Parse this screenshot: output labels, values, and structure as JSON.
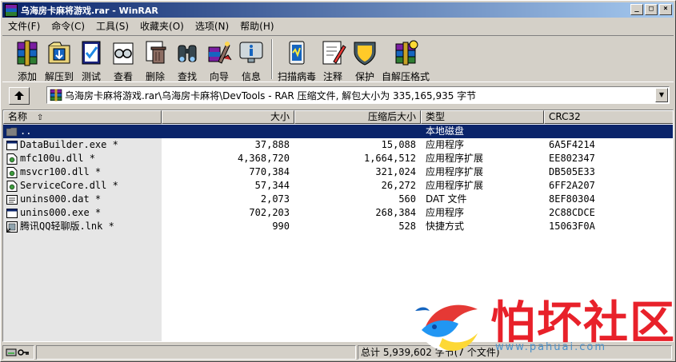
{
  "window": {
    "title": "乌海房卡麻将游戏.rar - WinRAR",
    "controls": {
      "minimize": "_",
      "maximize": "□",
      "close": "×"
    }
  },
  "menu": [
    "文件(F)",
    "命令(C)",
    "工具(S)",
    "收藏夹(O)",
    "选项(N)",
    "帮助(H)"
  ],
  "toolbar": [
    {
      "label": "添加",
      "icon": "add-archive-icon"
    },
    {
      "label": "解压到",
      "icon": "extract-to-icon"
    },
    {
      "label": "测试",
      "icon": "test-icon"
    },
    {
      "label": "查看",
      "icon": "view-icon"
    },
    {
      "label": "删除",
      "icon": "delete-icon"
    },
    {
      "label": "查找",
      "icon": "find-icon"
    },
    {
      "label": "向导",
      "icon": "wizard-icon"
    },
    {
      "label": "信息",
      "icon": "info-icon"
    },
    {
      "label": "扫描病毒",
      "icon": "virus-scan-icon"
    },
    {
      "label": "注释",
      "icon": "comment-icon"
    },
    {
      "label": "保护",
      "icon": "protect-icon"
    },
    {
      "label": "自解压格式",
      "icon": "sfx-icon"
    }
  ],
  "address": {
    "path": "乌海房卡麻将游戏.rar\\乌海房卡麻将\\DevTools - RAR 压缩文件, 解包大小为 335,165,935 字节"
  },
  "columns": {
    "name": "名称",
    "size": "大小",
    "packed": "压缩后大小",
    "type": "类型",
    "crc": "CRC32"
  },
  "files": [
    {
      "name": "..",
      "size": "",
      "packed": "",
      "type": "本地磁盘",
      "crc": "",
      "icon": "folder-icon",
      "selected": true
    },
    {
      "name": "DataBuilder.exe *",
      "size": "37,888",
      "packed": "15,088",
      "type": "应用程序",
      "crc": "6A5F4214",
      "icon": "exe-icon",
      "selected": false
    },
    {
      "name": "mfc100u.dll *",
      "size": "4,368,720",
      "packed": "1,664,512",
      "type": "应用程序扩展",
      "crc": "EE802347",
      "icon": "dll-icon",
      "selected": false
    },
    {
      "name": "msvcr100.dll *",
      "size": "770,384",
      "packed": "321,024",
      "type": "应用程序扩展",
      "crc": "DB505E33",
      "icon": "dll-icon",
      "selected": false
    },
    {
      "name": "ServiceCore.dll *",
      "size": "57,344",
      "packed": "26,272",
      "type": "应用程序扩展",
      "crc": "6FF2A207",
      "icon": "dll-icon",
      "selected": false
    },
    {
      "name": "unins000.dat *",
      "size": "2,073",
      "packed": "560",
      "type": "DAT 文件",
      "crc": "8EF80304",
      "icon": "dat-icon",
      "selected": false
    },
    {
      "name": "unins000.exe *",
      "size": "702,203",
      "packed": "268,384",
      "type": "应用程序",
      "crc": "2C88CDCE",
      "icon": "exe-icon",
      "selected": false
    },
    {
      "name": "腾讯QQ轻聊版.lnk *",
      "size": "990",
      "packed": "528",
      "type": "快捷方式",
      "crc": "15063F0A",
      "icon": "lnk-icon",
      "selected": false
    }
  ],
  "status": {
    "total": "总计 5,939,602 字节(7 个文件)"
  },
  "watermark": {
    "text": "怕坏社区",
    "url": "www.pahuai.com"
  }
}
